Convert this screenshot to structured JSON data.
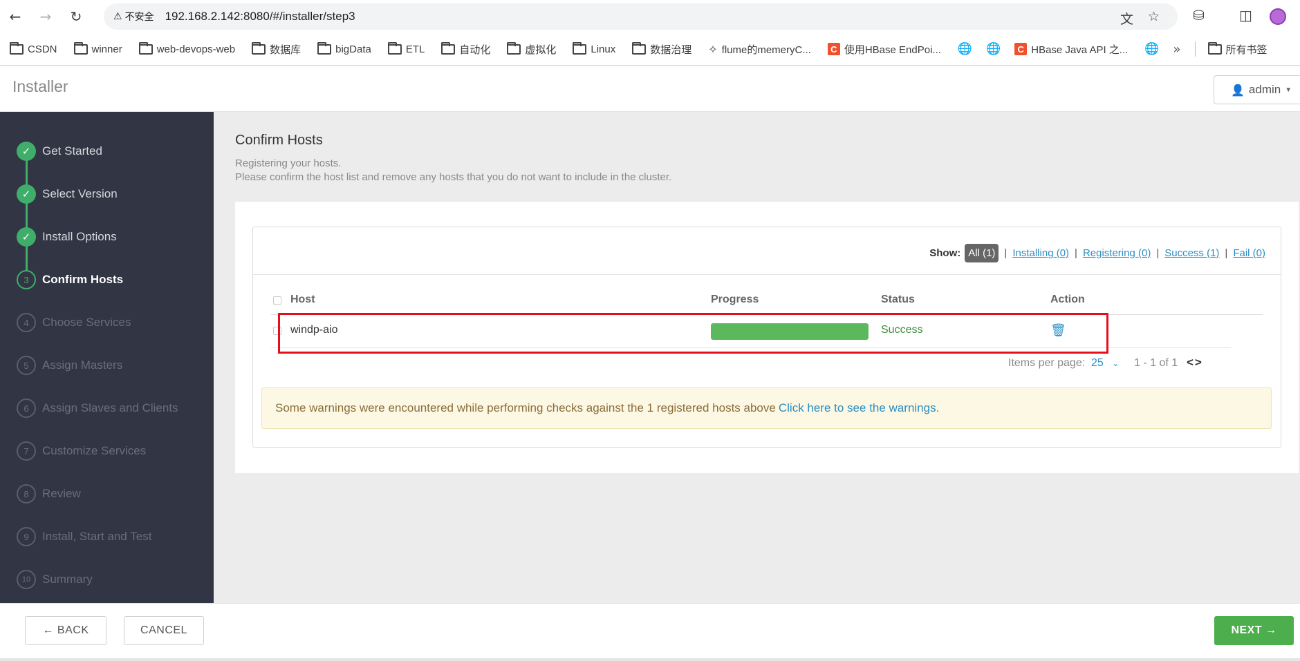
{
  "browser": {
    "security_label": "不安全",
    "url": "192.168.2.142:8080/#/installer/step3",
    "bookmarks": [
      {
        "label": "CSDN",
        "type": "folder"
      },
      {
        "label": "winner",
        "type": "folder"
      },
      {
        "label": "web-devops-web",
        "type": "folder"
      },
      {
        "label": "数据库",
        "type": "folder"
      },
      {
        "label": "bigData",
        "type": "folder"
      },
      {
        "label": "ETL",
        "type": "folder"
      },
      {
        "label": "自动化",
        "type": "folder"
      },
      {
        "label": "虚拟化",
        "type": "folder"
      },
      {
        "label": "Linux",
        "type": "folder"
      },
      {
        "label": "数据治理",
        "type": "folder"
      },
      {
        "label": "flume的memeryC...",
        "type": "page"
      },
      {
        "label": "使用HBase EndPoi...",
        "type": "csdn"
      },
      {
        "label": "HBase Java API 之...",
        "type": "csdn"
      },
      {
        "label": "所有书签",
        "type": "folder"
      }
    ]
  },
  "app": {
    "title": "Installer",
    "user": "admin"
  },
  "steps": [
    {
      "num": "1",
      "label": "Get Started",
      "state": "done"
    },
    {
      "num": "2",
      "label": "Select Version",
      "state": "done"
    },
    {
      "num": "3",
      "label": "Install Options",
      "state": "done"
    },
    {
      "num": "3",
      "label": "Confirm Hosts",
      "state": "current"
    },
    {
      "num": "4",
      "label": "Choose Services",
      "state": "todo"
    },
    {
      "num": "5",
      "label": "Assign Masters",
      "state": "todo"
    },
    {
      "num": "6",
      "label": "Assign Slaves and Clients",
      "state": "todo"
    },
    {
      "num": "7",
      "label": "Customize Services",
      "state": "todo"
    },
    {
      "num": "8",
      "label": "Review",
      "state": "todo"
    },
    {
      "num": "9",
      "label": "Install, Start and Test",
      "state": "todo"
    },
    {
      "num": "10",
      "label": "Summary",
      "state": "todo"
    }
  ],
  "main": {
    "title": "Confirm Hosts",
    "subtitle_1": "Registering your hosts.",
    "subtitle_2": "Please confirm the host list and remove any hosts that you do not want to include in the cluster.",
    "filters": {
      "show_label": "Show:",
      "all": "All (1)",
      "installing": "Installing (0)",
      "registering": "Registering (0)",
      "success": "Success (1)",
      "fail": "Fail (0)",
      "separator": "|"
    },
    "table": {
      "headers": {
        "host": "Host",
        "progress": "Progress",
        "status": "Status",
        "action": "Action"
      },
      "rows": [
        {
          "host": "windp-aio",
          "progress": 1.0,
          "status": "Success"
        }
      ]
    },
    "pager": {
      "items_label": "Items per page:",
      "items_value": "25",
      "range": "1 - 1 of 1",
      "arrows": "<>"
    },
    "warning": {
      "text": "Some warnings were encountered while performing checks against the 1 registered hosts above",
      "link": "Click here to see the warnings."
    }
  },
  "footer": {
    "back": "← BACK",
    "cancel": "CANCEL",
    "next": "NEXT →"
  },
  "colors": {
    "sidebar_bg": "#323544",
    "step_green": "#3fae6b",
    "progress_green": "#5cb85c",
    "link_blue": "#2a8ec5",
    "highlight_red": "#e3101a",
    "next_green": "#4cae4c"
  },
  "icons": {
    "back": "arrow-left-icon",
    "forward": "arrow-right-icon",
    "reload": "reload-icon",
    "warning": "warning-triangle-icon",
    "translate": "translate-icon",
    "bookmark_star": "star-icon",
    "extensions": "puzzle-icon",
    "sidepanel": "sidepanel-icon",
    "user": "user-icon",
    "delete": "trash-icon",
    "check": "check-icon"
  }
}
